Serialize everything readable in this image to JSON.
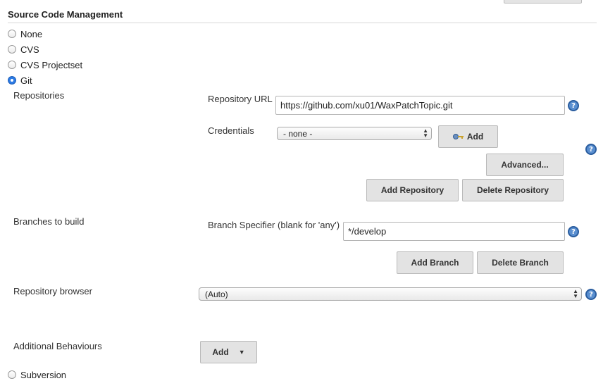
{
  "section": {
    "title": "Source Code Management"
  },
  "scm_options": [
    {
      "label": "None",
      "checked": false
    },
    {
      "label": "CVS",
      "checked": false
    },
    {
      "label": "CVS Projectset",
      "checked": false
    },
    {
      "label": "Git",
      "checked": true
    },
    {
      "label": "Subversion",
      "checked": false
    }
  ],
  "repositories": {
    "label": "Repositories",
    "url_label": "Repository URL",
    "url_value": "https://github.com/xu01/WaxPatchTopic.git",
    "credentials_label": "Credentials",
    "credentials_value": "- none -",
    "add_button": "Add",
    "advanced_button": "Advanced...",
    "add_repository_button": "Add Repository",
    "delete_repository_button": "Delete Repository"
  },
  "branches": {
    "label": "Branches to build",
    "specifier_label": "Branch Specifier (blank for 'any')",
    "specifier_value": "*/develop",
    "add_branch_button": "Add Branch",
    "delete_branch_button": "Delete Branch"
  },
  "repository_browser": {
    "label": "Repository browser",
    "value": "(Auto)"
  },
  "additional_behaviours": {
    "label": "Additional Behaviours",
    "add_button": "Add"
  },
  "icons": {
    "help": "help-icon",
    "key": "key-icon",
    "dropdown": "caret-down-icon",
    "select_arrows": "select-arrows-icon"
  },
  "colors": {
    "radio_checked": "#2c7be5",
    "help_icon": "#5a8fd0",
    "button_bg": "#e3e3e3"
  }
}
